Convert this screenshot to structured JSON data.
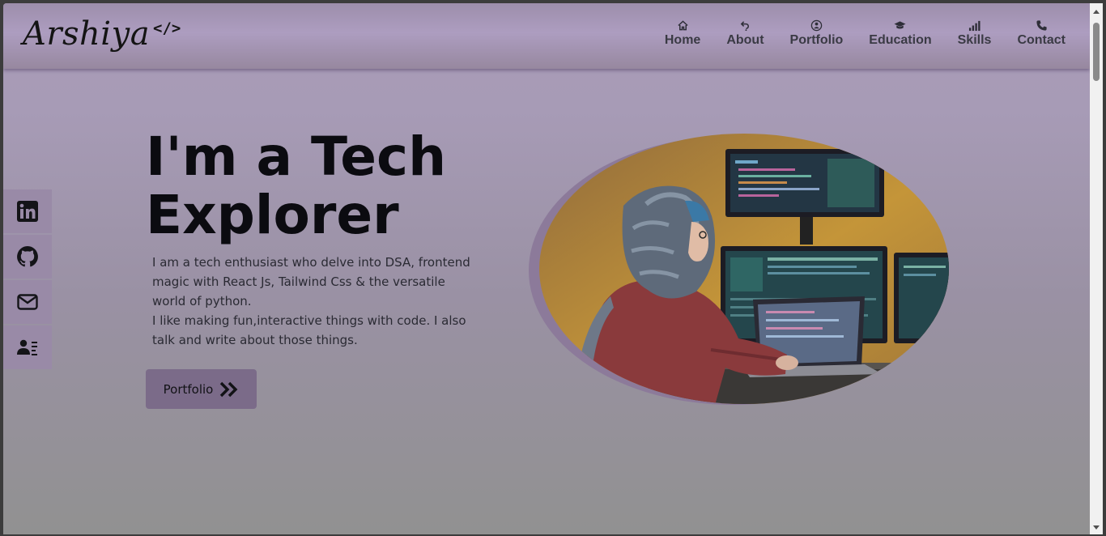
{
  "header": {
    "logo_text": "Arshiya",
    "logo_symbol": "</>",
    "nav": [
      {
        "label": "Home",
        "icon": "home-icon"
      },
      {
        "label": "About",
        "icon": "about-icon"
      },
      {
        "label": "Portfolio",
        "icon": "user-circle-icon"
      },
      {
        "label": "Education",
        "icon": "graduation-cap-icon"
      },
      {
        "label": "Skills",
        "icon": "signal-bars-icon"
      },
      {
        "label": "Contact",
        "icon": "phone-icon"
      }
    ]
  },
  "social": [
    {
      "name": "linkedin",
      "icon": "linkedin-icon"
    },
    {
      "name": "github",
      "icon": "github-icon"
    },
    {
      "name": "email",
      "icon": "mail-icon"
    },
    {
      "name": "resume",
      "icon": "contact-card-icon"
    }
  ],
  "hero": {
    "title_line1": "I'm a Tech",
    "title_line2": "Explorer",
    "description_1": "I am a tech enthusiast who delve into DSA, frontend magic with React Js, Tailwind Css & the versatile world of python.",
    "description_2": "I like making fun,interactive things with code. I also talk and write about those things.",
    "cta_label": "Portfolio",
    "cta_icon": "double-chevron-right-icon"
  },
  "colors": {
    "header_bg": "#ad9dc0",
    "page_bg_top": "#a99bb8",
    "page_bg_bottom": "#919191",
    "social_bg": "#998aa7",
    "button_bg": "#7b6b89",
    "title": "#0b0b10"
  }
}
